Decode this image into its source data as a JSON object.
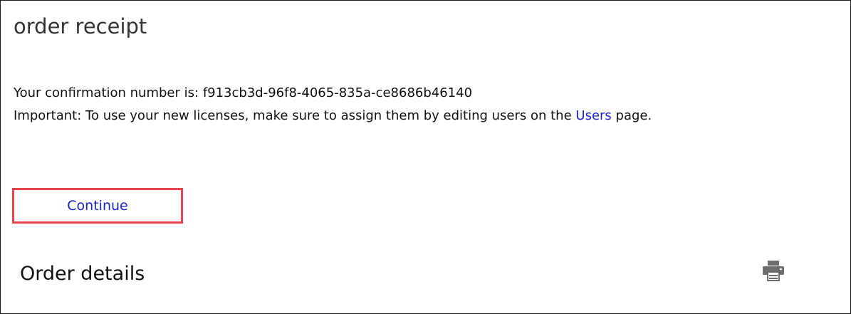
{
  "header": {
    "title": "order receipt"
  },
  "confirmation": {
    "label": "Your confirmation number is:",
    "number": "f913cb3d-96f8-4065-835a-ce8686b46140"
  },
  "important": {
    "text_before": "Important: To use your new licenses, make sure to assign them by editing users on the",
    "link_label": "Users",
    "text_after": "page."
  },
  "actions": {
    "continue_label": "Continue"
  },
  "order_details": {
    "heading": "Order details",
    "print_icon": "printer-icon"
  },
  "colors": {
    "link": "#1a24c4",
    "highlight_border": "#e8434f",
    "icon": "#6e6e6e"
  }
}
